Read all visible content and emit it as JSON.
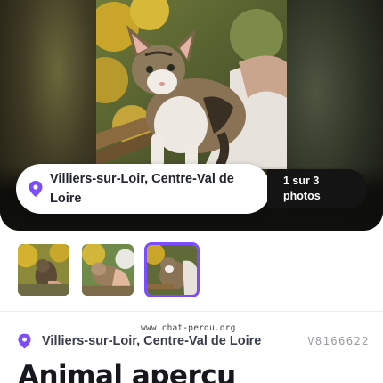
{
  "hero": {
    "location": "Villiers-sur-Loir, Centre-Val de Loire",
    "photo_counter": "1 sur 3 photos",
    "pin_icon": "map-pin-icon"
  },
  "thumbnails": [
    {
      "alt": "photo-1",
      "active": false
    },
    {
      "alt": "photo-2",
      "active": false
    },
    {
      "alt": "photo-3",
      "active": true
    }
  ],
  "info": {
    "location": "Villiers-sur-Loir, Centre-Val de Loire",
    "reference": "V8166622",
    "watermark": "www.chat-perdu.org"
  },
  "title": "Animal aperçu",
  "colors": {
    "accent": "#7c4dff",
    "text_dark": "#17181d"
  }
}
